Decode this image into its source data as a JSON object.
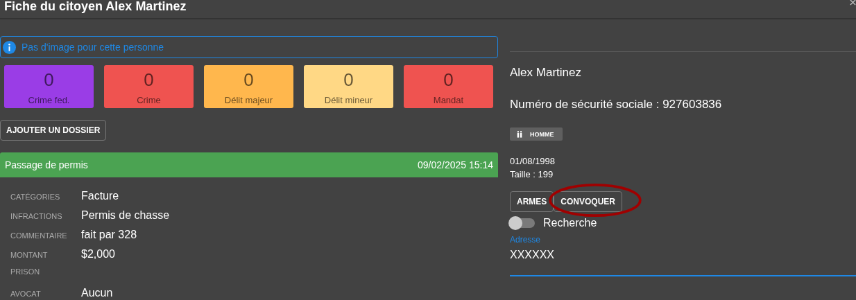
{
  "window": {
    "title": "Fiche du citoyen Alex Martinez"
  },
  "alert": {
    "text": "Pas d'image pour cette personne"
  },
  "counters": [
    {
      "value": "0",
      "label": "Crime fed.",
      "color": "#9a3de6"
    },
    {
      "value": "0",
      "label": "Crime",
      "color": "#ef5350"
    },
    {
      "value": "0",
      "label": "Délit majeur",
      "color": "#ffb74d"
    },
    {
      "value": "0",
      "label": "Délit mineur",
      "color": "#ffd885"
    },
    {
      "value": "0",
      "label": "Mandat",
      "color": "#ef5350"
    }
  ],
  "add_button": "AJOUTER UN DOSSIER",
  "record": {
    "title": "Passage de permis",
    "date": "09/02/2025 15:14",
    "fields": [
      {
        "label": "CATÉGORIES",
        "value": "Facture"
      },
      {
        "label": "INFRACTIONS",
        "value": "Permis de chasse"
      },
      {
        "label": "COMMENTAIRE",
        "value": "fait par 328"
      },
      {
        "label": "MONTANT",
        "value": "$2,000"
      },
      {
        "label": "PRISON"
      },
      {
        "label": "AVOCAT",
        "value": "Aucun"
      }
    ]
  },
  "person": {
    "name": "Alex Martinez",
    "ssn": "Numéro de sécurité sociale : 927603836",
    "gender": "HOMME",
    "birthdate": "01/08/1998",
    "height": "Taille : 199"
  },
  "actions": [
    "ARMES",
    "CONVOQUER"
  ],
  "toggle": {
    "label": "Recherche",
    "on": false
  },
  "address": {
    "label": "Adresse",
    "value": "XXXXXX"
  }
}
